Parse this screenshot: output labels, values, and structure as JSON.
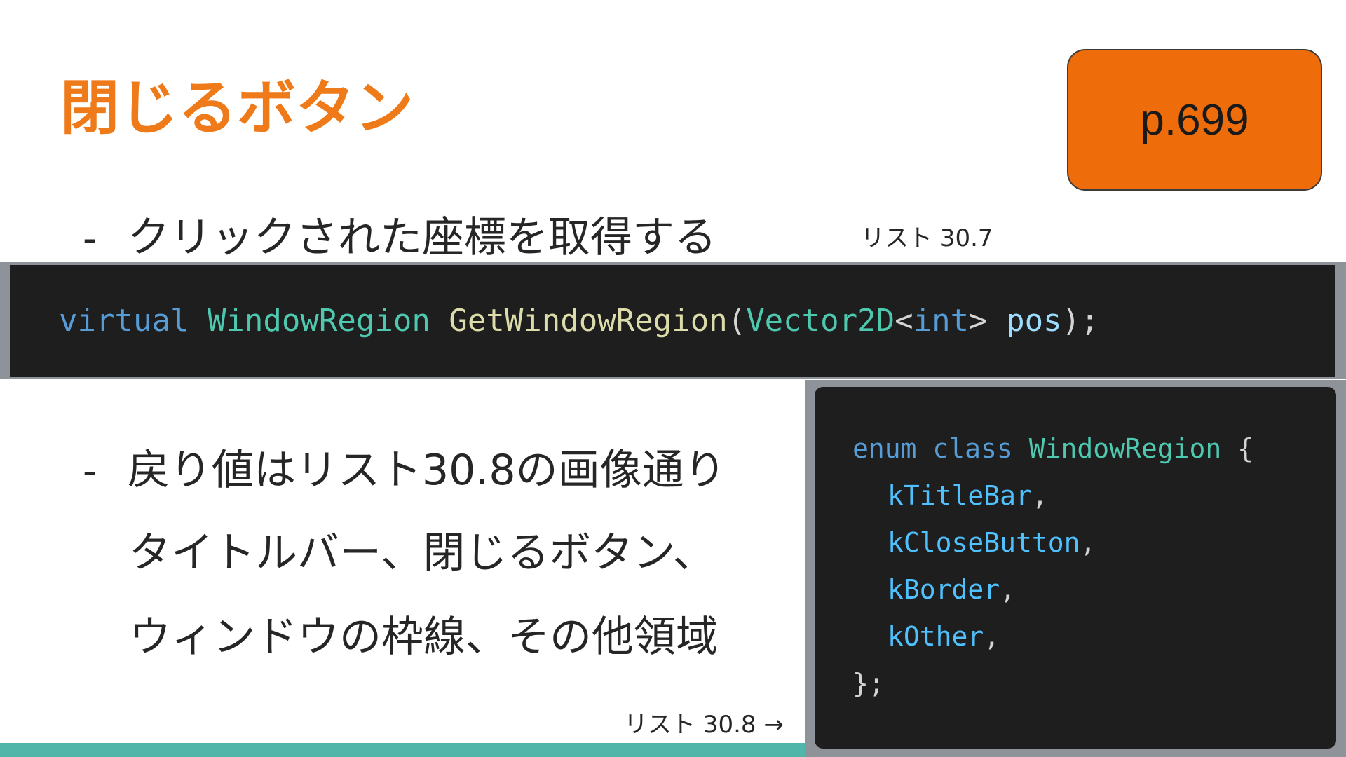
{
  "slide": {
    "title": "閉じるボタン",
    "page_badge": "p.699"
  },
  "bullets": [
    {
      "dash": "-",
      "text": "クリックされた座標を取得する"
    },
    {
      "dash": "-",
      "text": "戻り値はリスト30.8の画像通り"
    }
  ],
  "continuation_lines": [
    "タイトルバー、閉じるボタン、",
    "ウィンドウの枠線、その他領域"
  ],
  "captions": {
    "listing_30_7": "リスト 30.7",
    "listing_30_8": "リスト 30.8 →"
  },
  "code_30_7": {
    "kw_virtual": "virtual",
    "return_type": "WindowRegion",
    "function_name": "GetWindowRegion",
    "open_paren": "(",
    "param_type": "Vector2D",
    "lt": "<",
    "template_arg": "int",
    "gt": ">",
    "param_name": "pos",
    "close": ");"
  },
  "code_30_8": {
    "kw_enum": "enum",
    "kw_class": "class",
    "enum_name": "WindowRegion",
    "open_brace": "{",
    "members": [
      "kTitleBar",
      "kCloseButton",
      "kBorder",
      "kOther"
    ],
    "comma": ",",
    "close": "};"
  },
  "colors": {
    "title_orange": "#ee7a1a",
    "badge_orange": "#ee6c0a",
    "code_background": "#1e1e1e",
    "keyword_blue": "#569cd6",
    "type_teal": "#4ec9b0",
    "function_yellow": "#dcdcaa",
    "variable_lightblue": "#9cdcfe",
    "footer_teal": "#4fb6a9"
  }
}
